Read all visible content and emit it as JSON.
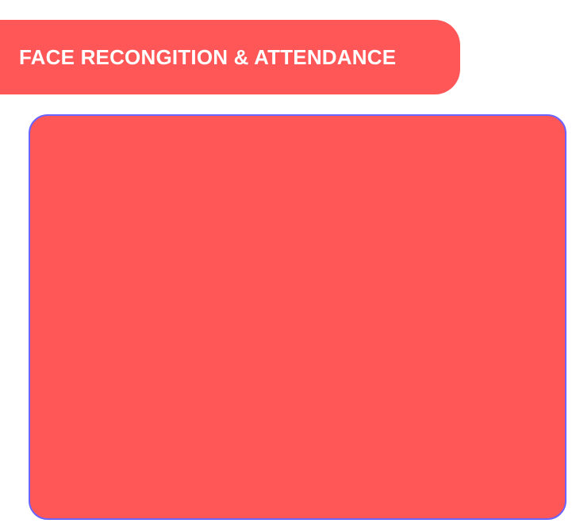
{
  "header": {
    "title": "FACE RECONGITION & ATTENDANCE"
  },
  "colors": {
    "accent": "#ff5757",
    "panel_outline": "#6b63ff",
    "title_text": "#ffffff",
    "background": "#ffffff"
  }
}
